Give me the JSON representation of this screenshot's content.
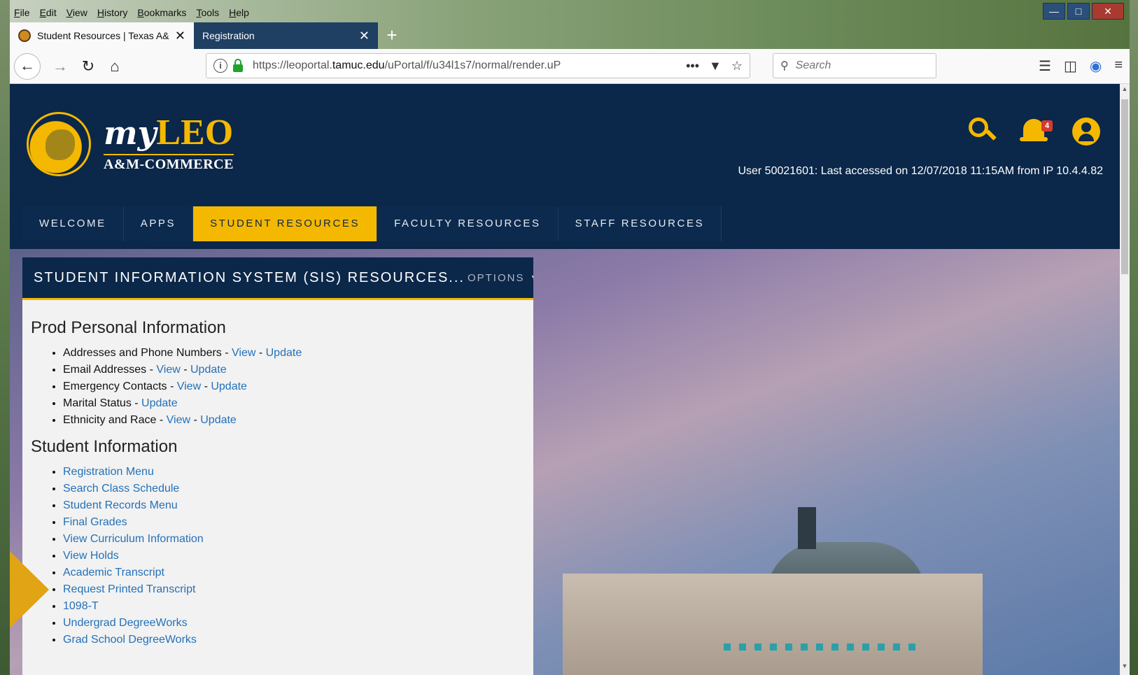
{
  "menubar": [
    "File",
    "Edit",
    "View",
    "History",
    "Bookmarks",
    "Tools",
    "Help"
  ],
  "tabs": [
    {
      "label": "Student Resources | Texas A&M",
      "active": true
    },
    {
      "label": "Registration",
      "active": false
    }
  ],
  "nav": {
    "url_prefix": "https://leoportal.",
    "url_domain": "tamuc.edu",
    "url_path": "/uPortal/f/u34l1s7/normal/render.uP",
    "search_placeholder": "Search"
  },
  "brand": {
    "my": "my",
    "leo": "LEO",
    "sub": "A&M-COMMERCE"
  },
  "header": {
    "notification_count": "4",
    "last_accessed": "User 50021601: Last accessed on 12/07/2018 11:15AM from IP 10.4.4.82"
  },
  "main_nav": [
    {
      "label": "WELCOME",
      "active": false
    },
    {
      "label": "APPS",
      "active": false
    },
    {
      "label": "STUDENT RESOURCES",
      "active": true
    },
    {
      "label": "FACULTY RESOURCES",
      "active": false
    },
    {
      "label": "STAFF RESOURCES",
      "active": false
    }
  ],
  "portlet": {
    "title": "STUDENT INFORMATION SYSTEM (SIS) RESOURCES...",
    "options": "OPTIONS",
    "sections": [
      {
        "heading": "Prod Personal Information",
        "items": [
          {
            "text": "Addresses and Phone Numbers - ",
            "links": [
              "View",
              "Update"
            ]
          },
          {
            "text": "Email Addresses - ",
            "links": [
              "View",
              "Update"
            ]
          },
          {
            "text": "Emergency Contacts - ",
            "links": [
              "View",
              "Update"
            ]
          },
          {
            "text": "Marital Status - ",
            "links": [
              "Update"
            ]
          },
          {
            "text": "Ethnicity and Race - ",
            "links": [
              "View",
              "Update"
            ]
          }
        ]
      },
      {
        "heading": "Student Information",
        "items": [
          {
            "text": "",
            "links": [
              "Registration Menu"
            ]
          },
          {
            "text": "",
            "links": [
              "Search Class Schedule"
            ]
          },
          {
            "text": "",
            "links": [
              "Student Records Menu"
            ]
          },
          {
            "text": "",
            "links": [
              "Final Grades"
            ]
          },
          {
            "text": "",
            "links": [
              "View Curriculum Information"
            ]
          },
          {
            "text": "",
            "links": [
              "View Holds"
            ]
          },
          {
            "text": "",
            "links": [
              "Academic Transcript"
            ]
          },
          {
            "text": "",
            "links": [
              "Request Printed Transcript"
            ]
          },
          {
            "text": "",
            "links": [
              "1098-T"
            ]
          },
          {
            "text": "",
            "links": [
              "Undergrad DegreeWorks"
            ]
          },
          {
            "text": "",
            "links": [
              "Grad School DegreeWorks"
            ]
          }
        ]
      }
    ]
  },
  "colors": {
    "navy": "#0b2749",
    "gold": "#f5b800",
    "link": "#2471b8"
  }
}
